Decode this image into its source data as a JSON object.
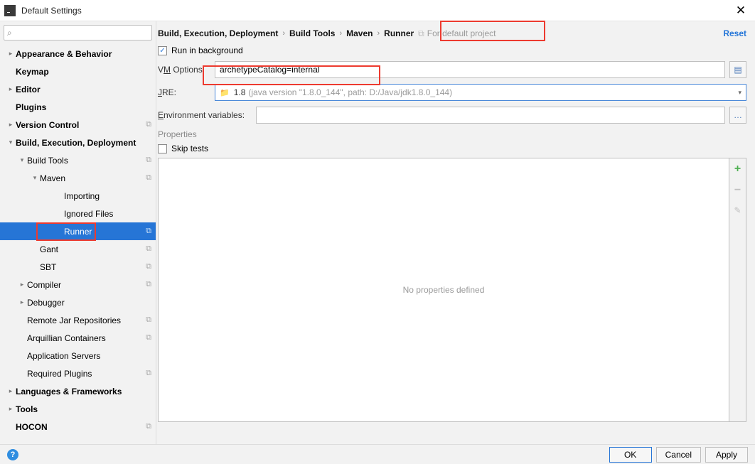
{
  "titlebar": {
    "title": "Default Settings"
  },
  "search": {
    "placeholder": ""
  },
  "sidebar": {
    "items": [
      {
        "label": "Appearance & Behavior",
        "level": 0,
        "bold": true,
        "chev": "right"
      },
      {
        "label": "Keymap",
        "level": 0,
        "bold": true
      },
      {
        "label": "Editor",
        "level": 0,
        "bold": true,
        "chev": "right"
      },
      {
        "label": "Plugins",
        "level": 0,
        "bold": true
      },
      {
        "label": "Version Control",
        "level": 0,
        "bold": true,
        "chev": "right",
        "copy": true
      },
      {
        "label": "Build, Execution, Deployment",
        "level": 0,
        "bold": true,
        "chev": "down"
      },
      {
        "label": "Build Tools",
        "level": 1,
        "chev": "down",
        "copy": true
      },
      {
        "label": "Maven",
        "level": 2,
        "chev": "down",
        "copy": true
      },
      {
        "label": "Importing",
        "level": 3
      },
      {
        "label": "Ignored Files",
        "level": 3
      },
      {
        "label": "Runner",
        "level": 3,
        "selected": true,
        "copy": true
      },
      {
        "label": "Gant",
        "level": 2,
        "copy": true
      },
      {
        "label": "SBT",
        "level": 2,
        "copy": true
      },
      {
        "label": "Compiler",
        "level": 1,
        "chev": "right",
        "copy": true
      },
      {
        "label": "Debugger",
        "level": 1,
        "chev": "right"
      },
      {
        "label": "Remote Jar Repositories",
        "level": 1,
        "copy": true
      },
      {
        "label": "Arquillian Containers",
        "level": 1,
        "copy": true
      },
      {
        "label": "Application Servers",
        "level": 1
      },
      {
        "label": "Required Plugins",
        "level": 1,
        "copy": true
      },
      {
        "label": "Languages & Frameworks",
        "level": 0,
        "bold": true,
        "chev": "right"
      },
      {
        "label": "Tools",
        "level": 0,
        "bold": true,
        "chev": "right"
      },
      {
        "label": "HOCON",
        "level": 0,
        "bold": true,
        "copy": true
      }
    ]
  },
  "breadcrumb": {
    "parts": [
      "Build, Execution, Deployment",
      "Build Tools",
      "Maven",
      "Runner"
    ],
    "default_proj": "For default project",
    "reset": "Reset"
  },
  "form": {
    "run_bg_label": "Run in background",
    "run_bg_checked": true,
    "vm_label_pre": "V",
    "vm_label_ul": "M",
    "vm_label_post": " Options:",
    "vm_value": "archetypeCatalog=internal",
    "jre_label_ul": "J",
    "jre_label_post": "RE:",
    "jre_value": "1.8",
    "jre_grey": "(java version \"1.8.0_144\", path: D:/Java/jdk1.8.0_144)",
    "env_label_ul": "E",
    "env_label_post": "nvironment variables:",
    "env_value": "",
    "props_label": "Properties",
    "skip_label_pre": "Skip ",
    "skip_label_ul": "t",
    "skip_label_post": "ests",
    "skip_checked": false,
    "no_props": "No properties defined"
  },
  "footer": {
    "ok": "OK",
    "cancel": "Cancel",
    "apply": "Apply"
  }
}
